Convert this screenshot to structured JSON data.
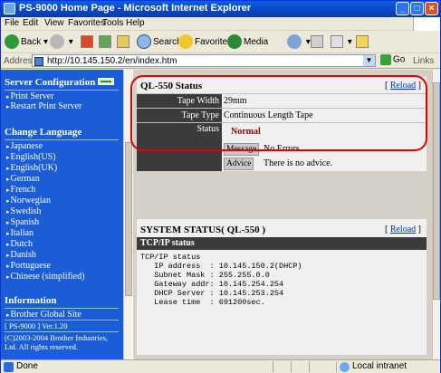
{
  "window": {
    "title": "PS-9000 Home Page - Microsoft Internet Explorer",
    "minimize": "_",
    "maximize": "□",
    "close": "×"
  },
  "menu": {
    "items": [
      "File",
      "Edit",
      "View",
      "Favorites",
      "Tools",
      "Help"
    ]
  },
  "toolbar": {
    "back": "Back",
    "search": "Search",
    "favorites": "Favorites",
    "media": "Media"
  },
  "address": {
    "label": "Address",
    "url": "http://10.145.150.2/en/index.htm",
    "go": "Go",
    "links": "Links"
  },
  "sidebar": {
    "server_config": {
      "title": "Server Configuration",
      "items": [
        "Print Server",
        "Restart Print Server"
      ]
    },
    "change_language": {
      "title": "Change Language",
      "items": [
        "Japanese",
        "English(US)",
        "English(UK)",
        "German",
        "French",
        "Norwegian",
        "Swedish",
        "Spanish",
        "Italian",
        "Dutch",
        "Danish",
        "Portuguese",
        "Chinese (simplified)"
      ]
    },
    "information": {
      "title": "Information",
      "items": [
        "Brother Global Site"
      ],
      "version": "[ PS-9000 ] Ver.1.20",
      "copyright": "(C)2003-2004 Brother Industries, Ltd. All rights reserved."
    }
  },
  "status_panel": {
    "title": "QL-550 Status",
    "reload": "Reload",
    "rows": {
      "tape_width_label": "Tape Width",
      "tape_width_value": "29mm",
      "tape_type_label": "Tape Type",
      "tape_type_value": "Continuous Length Tape",
      "status_label": "Status",
      "status_value": "Normal"
    },
    "message_key": "Message",
    "message_value": "No Errors.",
    "advice_key": "Advice",
    "advice_value": "There is no advice."
  },
  "system_status": {
    "title": "SYSTEM STATUS( QL-550 )",
    "reload": "Reload",
    "section": "TCP/IP status",
    "lines": [
      "TCP/IP status",
      "   IP address  : 10.145.150.2(DHCP)",
      "   Subnet Mask : 255.255.0.0",
      "   Gateway addr: 10.145.254.254",
      "   DHCP Server : 10.145.253.254",
      "   Lease time  : 691200sec."
    ]
  },
  "statusbar": {
    "done": "Done",
    "zone": "Local intranet"
  },
  "colors": {
    "sidebar_bg": "#1a5dd6",
    "header_dark": "#3b3b3b",
    "status_normal": "#a00000",
    "highlight_oval": "#e00000"
  }
}
